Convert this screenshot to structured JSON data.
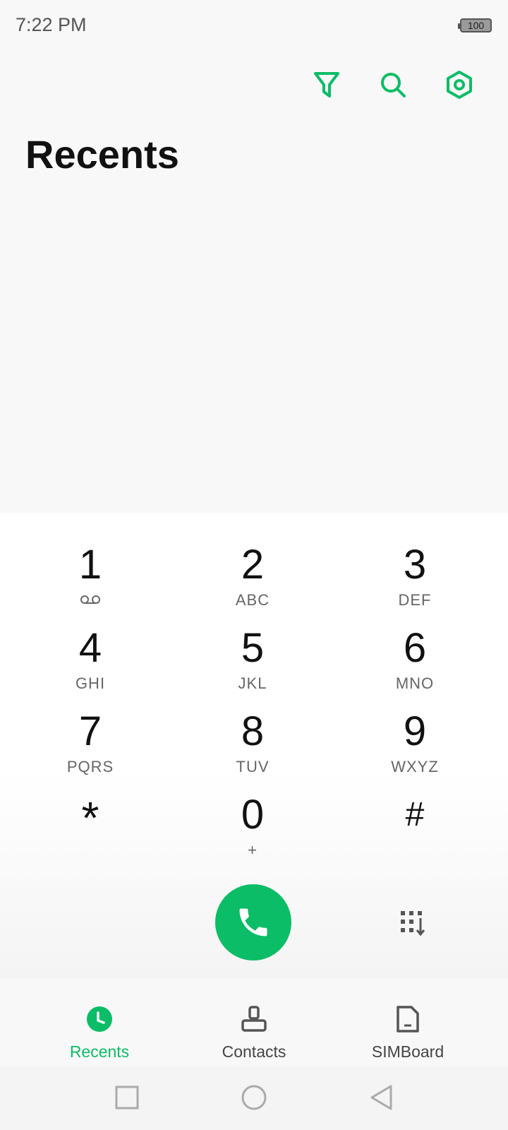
{
  "status_bar": {
    "time": "7:22 PM",
    "battery": "100"
  },
  "toolbar": {
    "icons": [
      "filter-icon",
      "search-icon",
      "settings-icon"
    ]
  },
  "page": {
    "title": "Recents"
  },
  "dialpad": {
    "keys": [
      {
        "digit": "1",
        "letters": "",
        "icon": "voicemail-icon"
      },
      {
        "digit": "2",
        "letters": "ABC"
      },
      {
        "digit": "3",
        "letters": "DEF"
      },
      {
        "digit": "4",
        "letters": "GHI"
      },
      {
        "digit": "5",
        "letters": "JKL"
      },
      {
        "digit": "6",
        "letters": "MNO"
      },
      {
        "digit": "7",
        "letters": "PQRS"
      },
      {
        "digit": "8",
        "letters": "TUV"
      },
      {
        "digit": "9",
        "letters": "WXYZ"
      },
      {
        "digit": "*",
        "letters": ""
      },
      {
        "digit": "0",
        "letters": "+"
      },
      {
        "digit": "#",
        "letters": ""
      }
    ]
  },
  "bottom_nav": {
    "tabs": [
      {
        "label": "Recents",
        "icon": "clock-icon",
        "active": true
      },
      {
        "label": "Contacts",
        "icon": "contact-icon",
        "active": false
      },
      {
        "label": "SIMBoard",
        "icon": "sim-card-icon",
        "active": false
      }
    ]
  },
  "colors": {
    "accent": "#0bbd66",
    "background": "#f8f8f8",
    "text": "#111111",
    "secondary_text": "#666666"
  }
}
